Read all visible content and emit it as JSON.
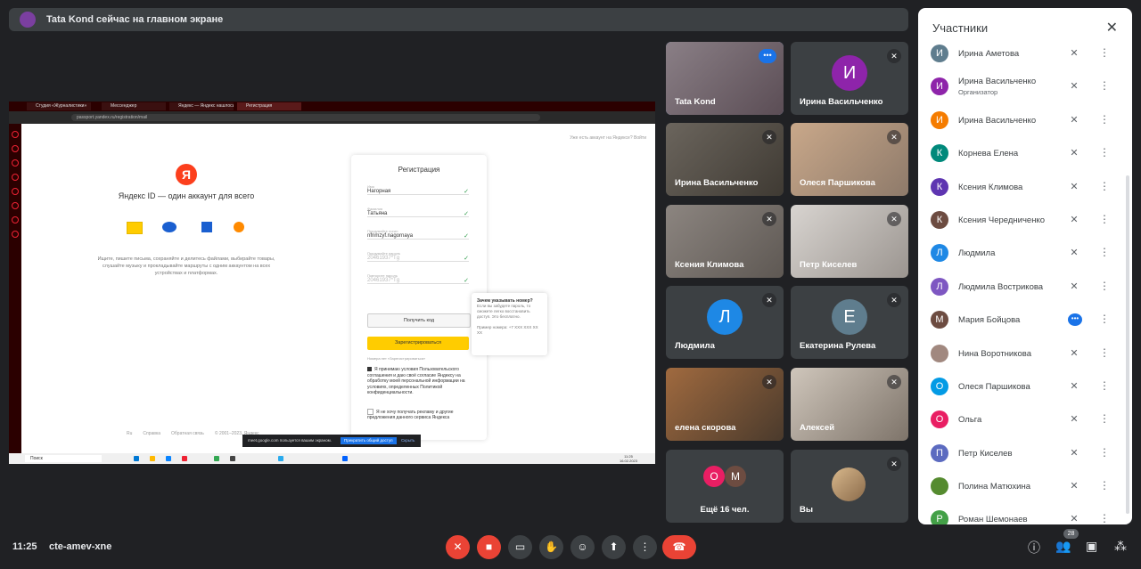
{
  "banner": {
    "text": "Tata Kond сейчас на главном экране"
  },
  "shared_screen": {
    "tabs": [
      "Студия «Журналистики»",
      "Мессенджер",
      "Яндекс — Яндекс нашлось",
      "Регистрация"
    ],
    "url": "passport.yandex.ru/registration/mail",
    "top_right": "Уже есть аккаунт на Яндексе? Войти",
    "logo": "Я",
    "title": "Яндекс ID — один аккаунт для всего",
    "description": "Ищите, пишите письма, сохраняйте и делитесь файлами, выбирайте товары, слушайте музыку и прокладывайте маршруты с одним аккаунтом на всех устройствах и платформах.",
    "footer": [
      "Ru",
      "Справка",
      "Обратная связь",
      "© 2001–2023, Яндекс"
    ],
    "form": {
      "title": "Регистрация",
      "fields": [
        {
          "label": "Имя",
          "value": "Нагорная"
        },
        {
          "label": "Фамилия",
          "value": "Татьяна"
        },
        {
          "label": "Придумайте логин",
          "value": "nfnmzyf.nagornaya"
        },
        {
          "label": "Придумайте пароль",
          "value": "20461937*Tg"
        },
        {
          "label": "Повторите пароль",
          "value": "20461937*Tg"
        }
      ],
      "get_code": "Получить код",
      "register": "Зарегистрироваться",
      "no_phone": "Номера нет «Зарегистрироваться»",
      "agree": "Я принимаю условия Пользовательского соглашения и даю своё согласие Яндексу на обработку моей персональной информации на условиях, определенных Политикой конфиденциальности.",
      "no_ads": "Я не хочу получать рекламу и другие предложения данного сервиса Яндекса"
    },
    "tooltip": {
      "title": "Зачем указывать номер?",
      "text": "Если вы забудете пароль, то сможете легко восстановить доступ. Это бесплатно.",
      "example": "Пример номера: +7 XXX XXX XX XX"
    },
    "share_bar": {
      "text": "meet.google.com пользуется вашим экраном.",
      "stop": "Прекратить общий доступ",
      "hide": "Скрыть"
    },
    "taskbar": {
      "search": "Поиск",
      "time": "11:25",
      "date": "16.02.2023"
    }
  },
  "tiles": [
    {
      "name": "Tata Kond"
    },
    {
      "name": "Ирина Васильченко",
      "initial": "И",
      "color": "#8e24aa"
    },
    {
      "name": "Ирина Васильченко"
    },
    {
      "name": "Олеся Паршикова"
    },
    {
      "name": "Ксения Климова"
    },
    {
      "name": "Петр Киселев"
    },
    {
      "name": "Людмила",
      "initial": "Л",
      "color": "#1e88e5"
    },
    {
      "name": "Екатерина Рулева",
      "initial": "Е",
      "color": "#5f7d8e"
    },
    {
      "name": "елена скорова"
    },
    {
      "name": "Алексей"
    },
    {
      "name": "Ещё 16 чел.",
      "initials": [
        "О",
        "М"
      ]
    },
    {
      "name": "Вы"
    }
  ],
  "panel": {
    "title": "Участники",
    "participants": [
      {
        "name": "Ирина Аметова",
        "initial": "И",
        "color": "#5f7d8e"
      },
      {
        "name": "Ирина Васильченко",
        "role": "Организатор",
        "initial": "И",
        "color": "#8e24aa"
      },
      {
        "name": "Ирина Васильченко",
        "initial": "И",
        "color": "#f57c00"
      },
      {
        "name": "Корнева Елена",
        "initial": "К",
        "color": "#00897b"
      },
      {
        "name": "Ксения Климова",
        "initial": "К",
        "color": "#5e35b1"
      },
      {
        "name": "Ксения Чередниченко",
        "initial": "К",
        "color": "#6d4c41"
      },
      {
        "name": "Людмила",
        "initial": "Л",
        "color": "#1e88e5"
      },
      {
        "name": "Людмила Вострикова",
        "initial": "Л",
        "color": "#7e57c2"
      },
      {
        "name": "Мария Бойцова",
        "initial": "М",
        "color": "#6d4c41",
        "speaking": true
      },
      {
        "name": "Нина Воротникова",
        "initial": "",
        "color": "#a1887f"
      },
      {
        "name": "Олеся Паршикова",
        "initial": "О",
        "color": "#039be5"
      },
      {
        "name": "Ольга",
        "initial": "О",
        "color": "#e91e63"
      },
      {
        "name": "Петр Киселев",
        "initial": "П",
        "color": "#5c6bc0"
      },
      {
        "name": "Полина Матюхина",
        "initial": "",
        "color": "#558b2f"
      },
      {
        "name": "Роман Шемонаев",
        "initial": "Р",
        "color": "#43a047"
      }
    ]
  },
  "bottom": {
    "time": "11:25",
    "meeting_code": "cte-amev-xne",
    "participant_count": "28"
  }
}
